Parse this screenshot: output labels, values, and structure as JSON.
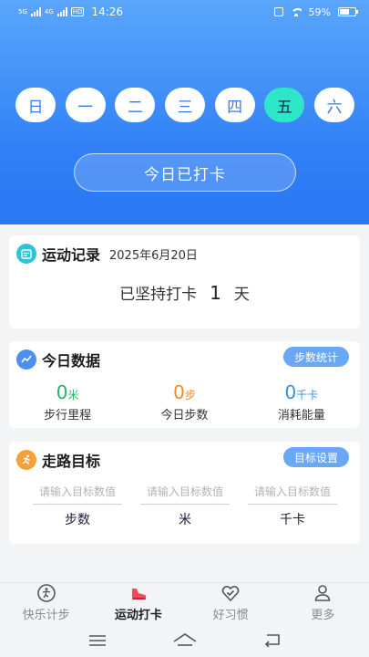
{
  "status_bar": {
    "sig1": "5G",
    "sig2": "4G",
    "hd": "HD",
    "time": "14:26",
    "battery": "59%"
  },
  "week": {
    "days": [
      "日",
      "一",
      "二",
      "三",
      "四",
      "五",
      "六"
    ],
    "active_index": 5
  },
  "checkin_button": "今日已打卡",
  "record": {
    "title": "运动记录",
    "date": "2025年6月20日",
    "prefix": "已坚持打卡",
    "count": "1",
    "suffix": "天"
  },
  "today": {
    "title": "今日数据",
    "action": "步数统计",
    "stats": [
      {
        "value": "0",
        "unit": "米",
        "label": "步行里程",
        "color": "#23b466"
      },
      {
        "value": "0",
        "unit": "步",
        "label": "今日步数",
        "color": "#f08a2a"
      },
      {
        "value": "0",
        "unit": "千卡",
        "label": "消耗能量",
        "color": "#3d8fe0"
      }
    ]
  },
  "goal": {
    "title": "走路目标",
    "action": "目标设置",
    "fields": [
      {
        "placeholder": "请输入目标数值",
        "label": "步数"
      },
      {
        "placeholder": "请输入目标数值",
        "label": "米"
      },
      {
        "placeholder": "请输入目标数值",
        "label": "千卡"
      }
    ]
  },
  "tabs": [
    {
      "label": "快乐计步",
      "icon": "walker-icon"
    },
    {
      "label": "运动打卡",
      "icon": "shoe-icon",
      "active": true
    },
    {
      "label": "好习惯",
      "icon": "heart-check-icon"
    },
    {
      "label": "更多",
      "icon": "person-icon"
    }
  ],
  "colors": {
    "accent": "#2f7ff6",
    "active_day": "#2ee6c8",
    "pill": "#6aa7f6"
  }
}
